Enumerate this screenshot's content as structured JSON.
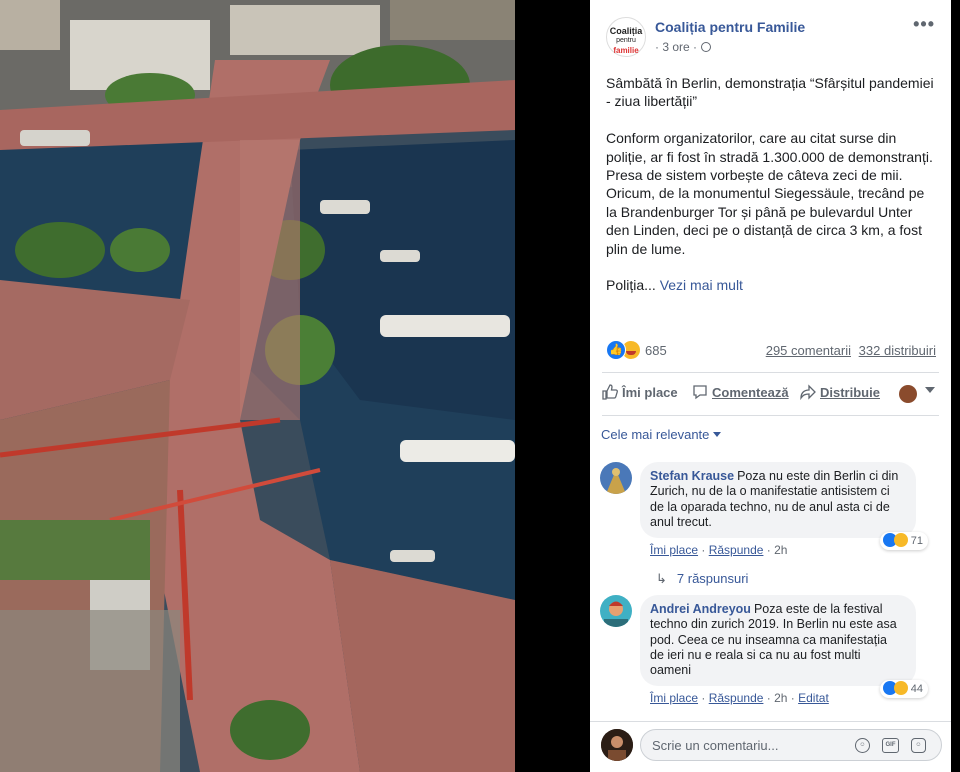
{
  "post": {
    "page_name": "Coaliția pentru Familie",
    "logo_line1": "Coaliția",
    "logo_line2": "pentru",
    "logo_line3": "familie",
    "time": "· 3 ore ·",
    "paragraph1": "Sâmbătă în Berlin, demonstrația “Sfârșitul pandemiei - ziua libertății”",
    "paragraph2": "Conform organizatorilor, care au citat surse din poliție, ar fi fost în stradă 1.300.000 de demonstranți. Presa de sistem vorbește de câteva zeci de mii. Oricum, de la monumentul Siegessäule, trecând pe la Brandenburger Tor și până pe bulevardul Unter den Linden, deci pe o distanță de circa 3 km, a fost plin de lume.",
    "paragraph3": "Poliția...",
    "see_more": "Vezi mai mult"
  },
  "stats": {
    "reactions": "685",
    "comments": "295 comentarii",
    "shares": "332 distribuiri"
  },
  "actions": {
    "like": "Îmi place",
    "comment": "Comentează",
    "share": "Distribuie"
  },
  "sort": {
    "label": "Cele mai relevante"
  },
  "comments": [
    {
      "author": "Stefan Krause",
      "text": "Poza nu este din Berlin ci din Zurich, nu de la o manifestatie antisistem ci de la oparada techno, nu de anul asta ci de anul trecut.",
      "reactions": "71",
      "like": "Îmi place",
      "reply": "Răspunde",
      "time": "2h",
      "edited": ""
    },
    {
      "author": "Andrei Andreyou",
      "text": "Poza este de la festival techno din zurich 2019. In Berlin nu este asa pod. Ceea ce nu inseamna ca manifestația de ieri nu e reala si ca nu au fost multi oameni",
      "reactions": "44",
      "like": "Îmi place",
      "reply": "Răspunde",
      "time": "2h",
      "edited": "Editat"
    }
  ],
  "replies": {
    "label": "7 răspunsuri"
  },
  "composer": {
    "placeholder": "Scrie un comentariu..."
  },
  "colors": {
    "link": "#385898",
    "like_blue": "#1877f2",
    "haha_yellow": "#f7b928"
  }
}
